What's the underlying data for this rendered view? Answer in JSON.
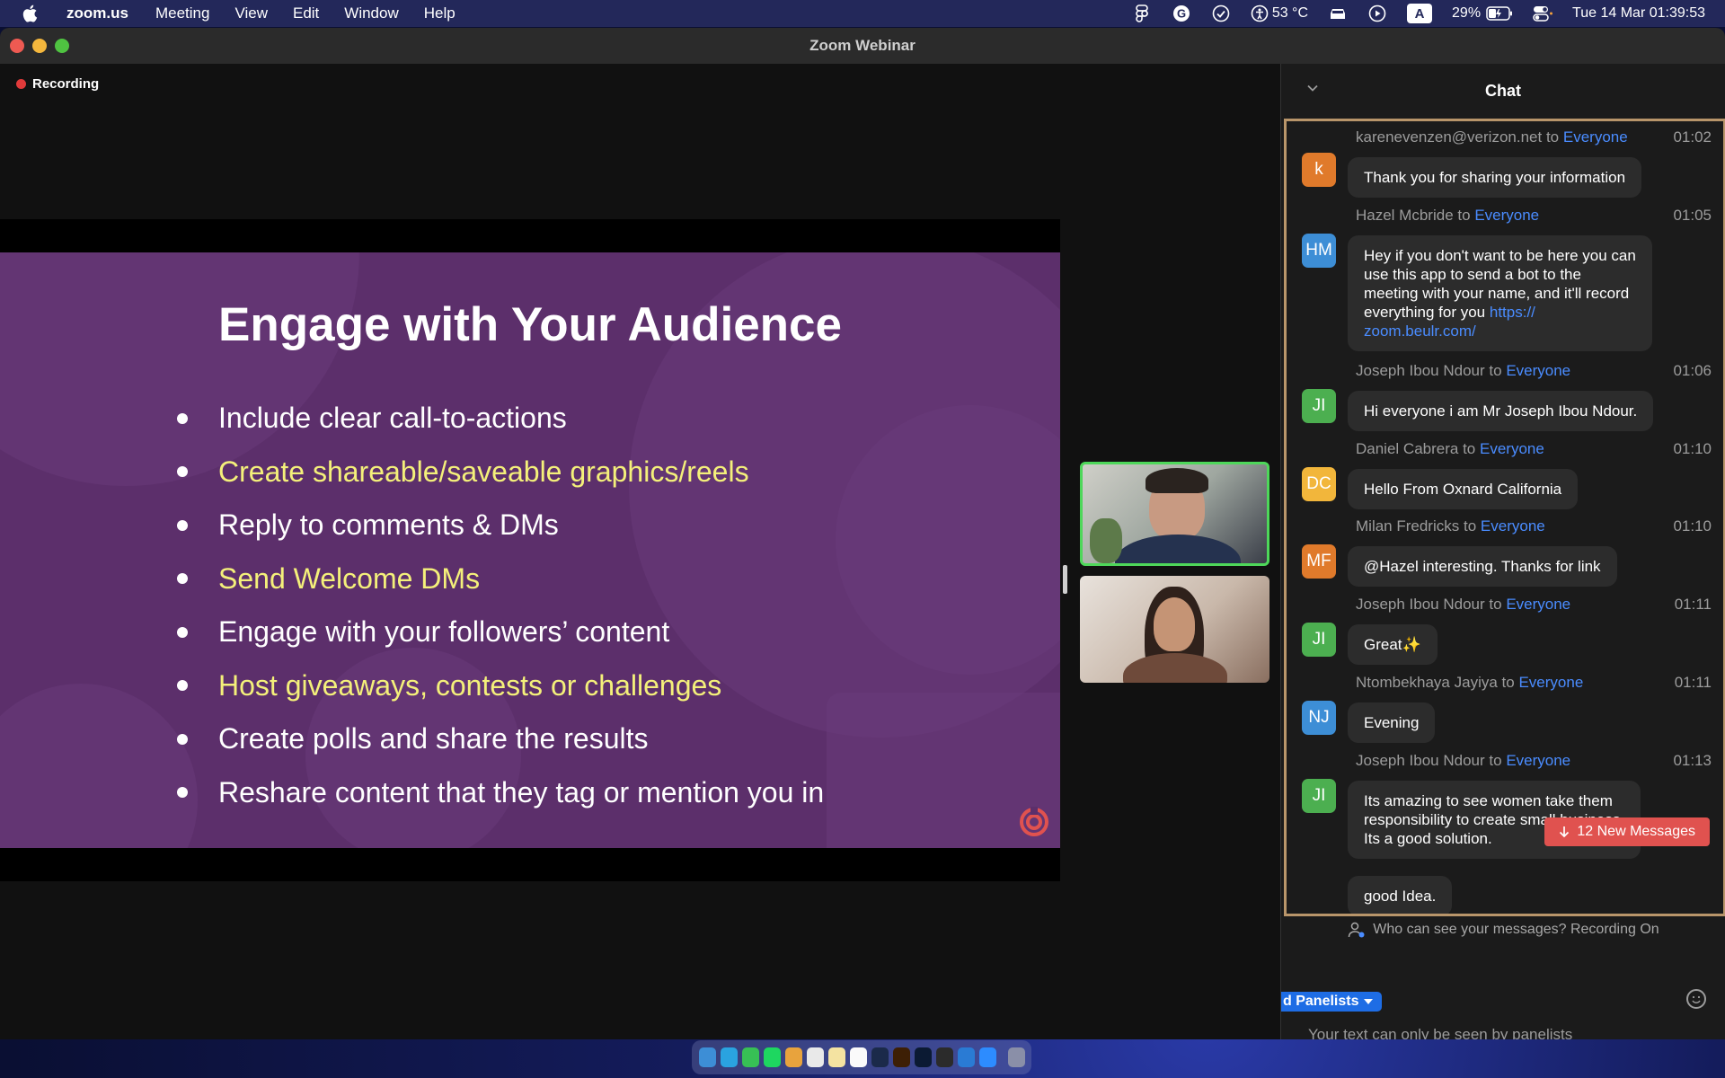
{
  "menubar": {
    "app_name": "zoom.us",
    "items": [
      "Meeting",
      "View",
      "Edit",
      "Window",
      "Help"
    ],
    "temperature": "53 °C",
    "battery": "29%",
    "keyboard": "A",
    "datetime": "Tue 14 Mar  01:39:53"
  },
  "window": {
    "title": "Zoom Webinar",
    "recording_label": "Recording"
  },
  "slide": {
    "title": "Engage with Your Audience",
    "bullets": [
      {
        "text": "Include clear call-to-actions",
        "highlight": false
      },
      {
        "text": "Create shareable/saveable graphics/reels",
        "highlight": true
      },
      {
        "text": "Reply to comments & DMs",
        "highlight": false
      },
      {
        "text": "Send Welcome DMs",
        "highlight": true
      },
      {
        "text": "Engage with your followers’ content",
        "highlight": false
      },
      {
        "text": "Host giveaways, contests or challenges",
        "highlight": true
      },
      {
        "text": "Create polls and share the results",
        "highlight": false
      },
      {
        "text": "Reshare content that they tag or mention you in",
        "highlight": false
      }
    ],
    "colors": {
      "background": "#5c2f6b",
      "highlight": "#f4f07a",
      "logo": "#e0524f"
    }
  },
  "chat": {
    "title": "Chat",
    "to_word": "to",
    "messages": [
      {
        "initials": "k",
        "color": "#e07a2b",
        "sender": "karenevenzen@verizon.net",
        "recipient": "Everyone",
        "time": "01:02",
        "text": "Thank you for sharing your information"
      },
      {
        "initials": "HM",
        "color": "#3d8ed6",
        "sender": "Hazel Mcbride",
        "recipient": "Everyone",
        "time": "01:05",
        "lines": [
          "Hey if you don't want to be here you can",
          "use this app to send a bot to the",
          "meeting with your name, and it'll record",
          "everything for you "
        ],
        "link": [
          "https://",
          "zoom.beulr.com/"
        ]
      },
      {
        "initials": "JI",
        "color": "#4caf50",
        "sender": "Joseph Ibou Ndour",
        "recipient": "Everyone",
        "time": "01:06",
        "text": "Hi everyone i am Mr Joseph Ibou Ndour."
      },
      {
        "initials": "DC",
        "color": "#f2b63b",
        "sender": "Daniel Cabrera",
        "recipient": "Everyone",
        "time": "01:10",
        "text": "Hello From Oxnard California"
      },
      {
        "initials": "MF",
        "color": "#e07a2b",
        "sender": "Milan Fredricks",
        "recipient": "Everyone",
        "time": "01:10",
        "text": "@Hazel interesting. Thanks for link"
      },
      {
        "initials": "JI",
        "color": "#4caf50",
        "sender": "Joseph Ibou Ndour",
        "recipient": "Everyone",
        "time": "01:11",
        "text": "Great✨"
      },
      {
        "initials": "NJ",
        "color": "#3d8ed6",
        "sender": "Ntombekhaya Jayiya",
        "recipient": "Everyone",
        "time": "01:11",
        "text": "Evening"
      },
      {
        "initials": "JI",
        "color": "#4caf50",
        "sender": "Joseph Ibou Ndour",
        "recipient": "Everyone",
        "time": "01:13",
        "lines": [
          "Its amazing to see women take them",
          "responsibility to create small business.",
          "Its a good solution."
        ],
        "followup": "good Idea."
      }
    ],
    "new_messages": "12 New Messages",
    "privacy_note": "Who can see your messages? Recording On",
    "to_badge": "d Panelists",
    "input_placeholder": "Your text can only be seen by panelists"
  },
  "colors": {
    "link": "#4a8cff",
    "active_speaker_border": "#4ed75a",
    "recording_dot": "#e03a3a",
    "new_messages_bg": "#e0524f"
  }
}
